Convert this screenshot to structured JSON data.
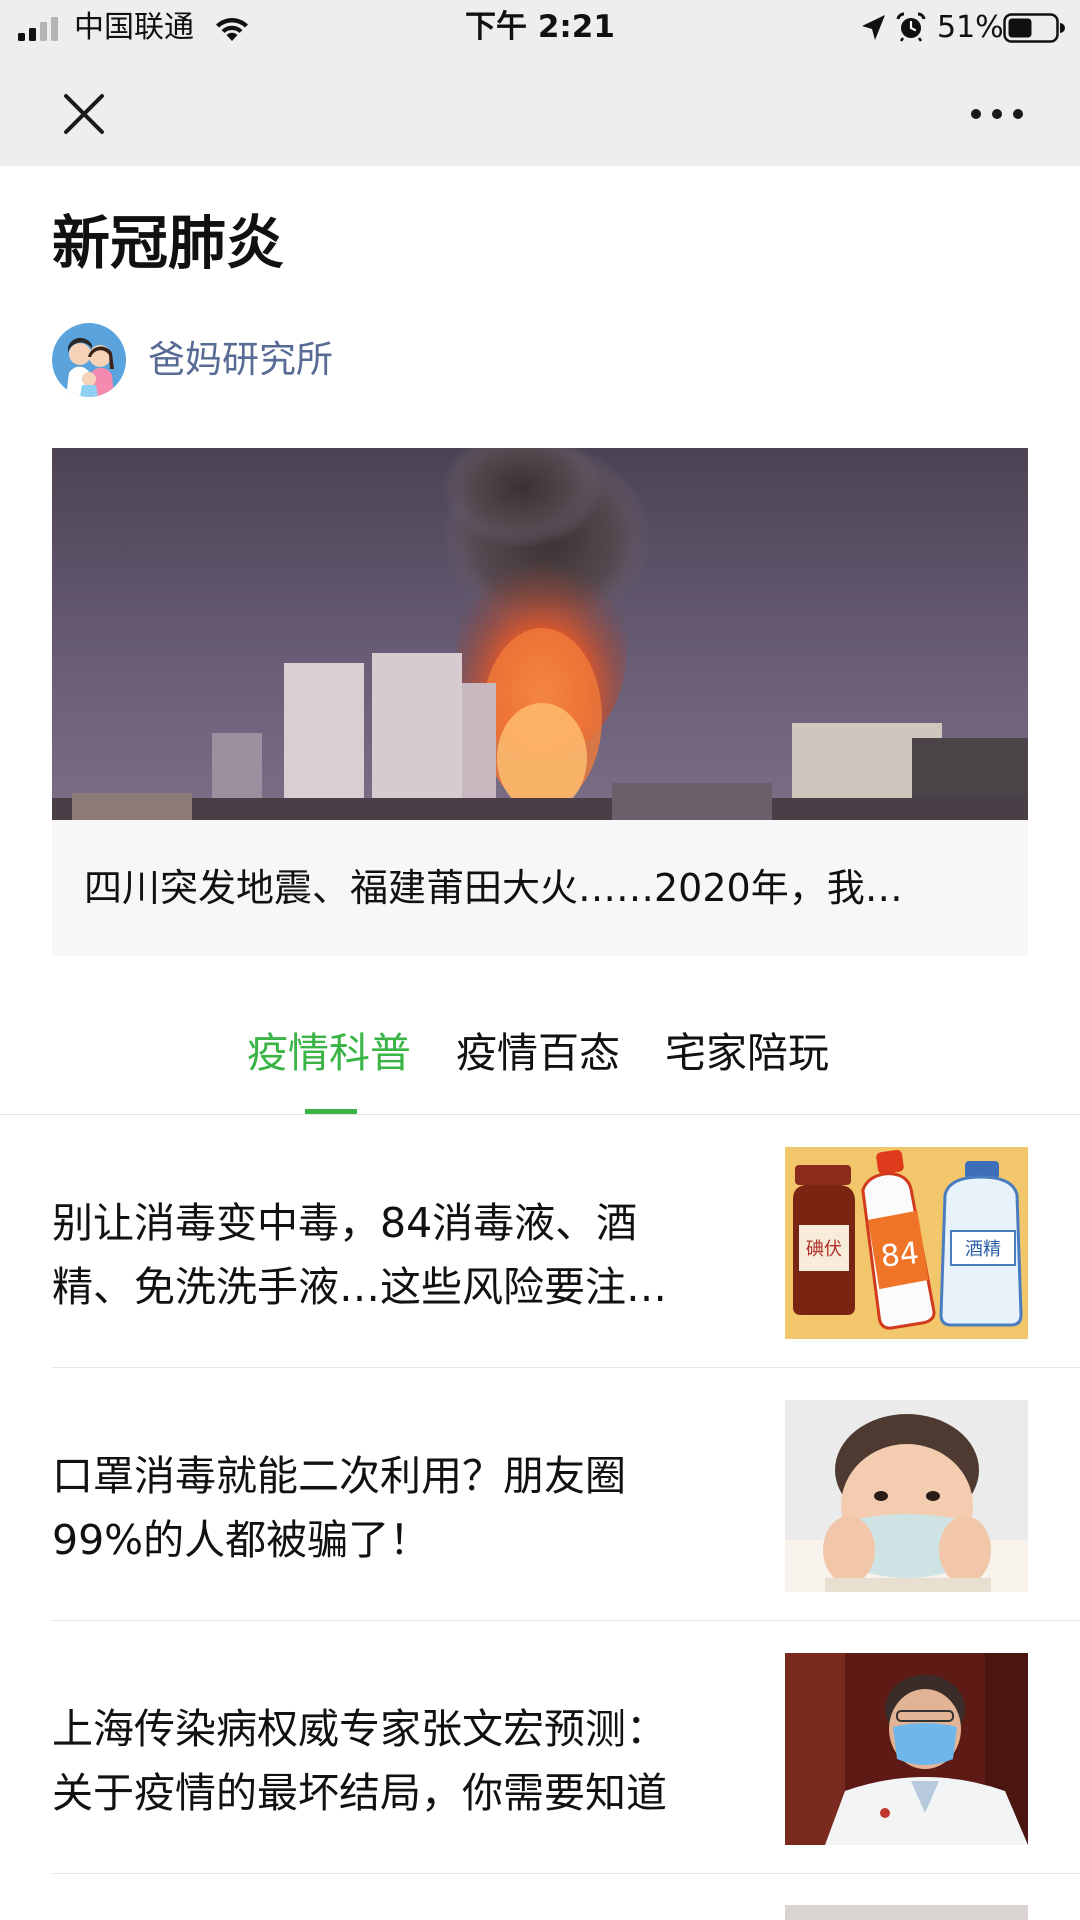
{
  "status_bar": {
    "carrier": "中国联通",
    "time": "下午 2:21",
    "battery": "51%",
    "battery_level": 0.51
  },
  "nav": {
    "close_icon": "close-icon",
    "more_icon": "more-icon"
  },
  "page": {
    "title": "新冠肺炎"
  },
  "author": {
    "name": "爸妈研究所"
  },
  "feature": {
    "caption": "四川突发地震、福建莆田大火……2020年，我…",
    "image": "city-fire-at-night-image"
  },
  "tabs": [
    {
      "label": "疫情科普",
      "active": true
    },
    {
      "label": "疫情百态",
      "active": false
    },
    {
      "label": "宅家陪玩",
      "active": false
    }
  ],
  "articles": [
    {
      "title_line1": "别让消毒变中毒，84消毒液、酒",
      "title_line2": "精、免洗洗手液…这些风险要注…",
      "thumb": "disinfectant-bottles-image",
      "thumb_labels": [
        "碘伏",
        "84",
        "酒精"
      ]
    },
    {
      "title_line1": "口罩消毒就能二次利用？朋友圈",
      "title_line2": "99%的人都被骗了！",
      "thumb": "child-wearing-mask-image"
    },
    {
      "title_line1": "上海传染病权威专家张文宏预测：",
      "title_line2": "关于疫情的最坏结局，你需要知道",
      "thumb": "doctor-wearing-mask-image"
    }
  ],
  "colors": {
    "accent_green": "#3ab545",
    "link_blue": "#576b95",
    "topbar_gray": "#eeeeee"
  }
}
